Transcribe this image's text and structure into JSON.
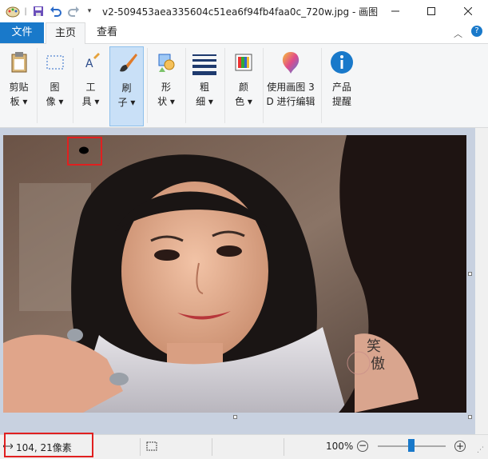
{
  "window": {
    "title": "v2-509453aea335604c51ea6f94fb4faa0c_720w.jpg - 画图"
  },
  "tabs": {
    "file": "文件",
    "home": "主页",
    "view": "查看"
  },
  "ribbon": {
    "clipboard": "剪贴\n板 ▾",
    "image": "图\n像 ▾",
    "tools": "工\n具 ▾",
    "brushes": "刷\n子 ▾",
    "shapes": "形\n状 ▾",
    "size": "粗\n细 ▾",
    "colors": "颜\n色 ▾",
    "paint3d": "使用画图 3\nD 进行编辑",
    "product_alert": "产品\n提醒"
  },
  "status": {
    "cursor_position": "104, 21像素",
    "zoom": "100%"
  },
  "colors": {
    "accent": "#1979ca",
    "highlight_red": "#e02020"
  }
}
